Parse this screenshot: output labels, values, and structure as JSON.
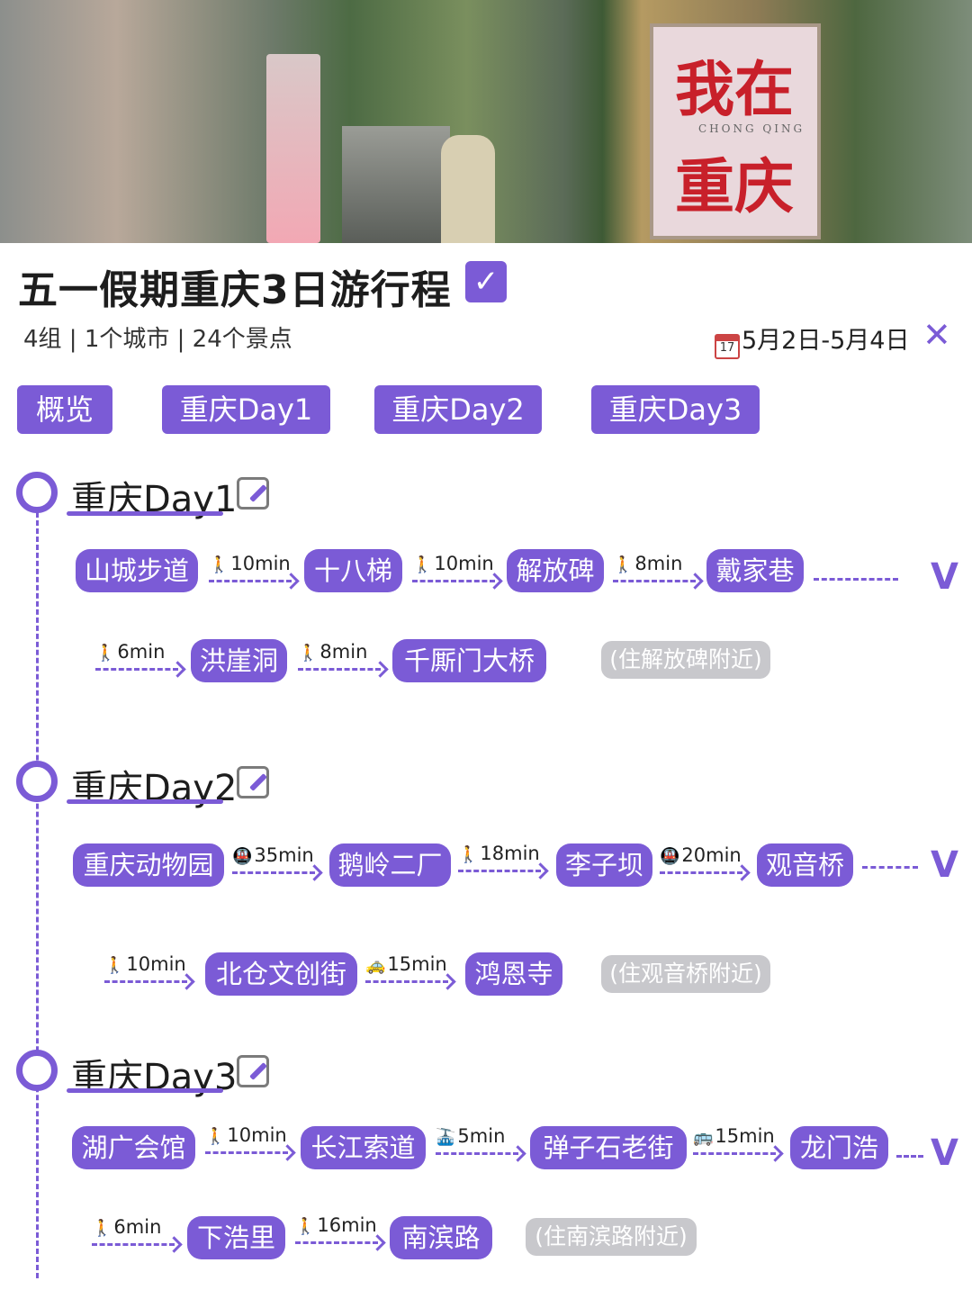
{
  "header": {
    "billboard_line1": "我在",
    "billboard_sub": "CHONG QING",
    "billboard_line2": "重庆"
  },
  "title": "五一假期重庆3日游行程",
  "meta": "4组 | 1个城市 | 24个景点",
  "date_icon_text": "17",
  "date_range": "5月2日-5月4日",
  "close_glyph": "✕",
  "check_glyph": "✓",
  "tabs": [
    "概览",
    "重庆Day1",
    "重庆Day2",
    "重庆Day3"
  ],
  "days": [
    {
      "title": "重庆Day1",
      "spots": [
        "山城步道",
        "十八梯",
        "解放碑",
        "戴家巷",
        "洪崖洞",
        "千厮门大桥"
      ],
      "legs": [
        {
          "mode": "walk",
          "time": "10min"
        },
        {
          "mode": "walk",
          "time": "10min"
        },
        {
          "mode": "walk",
          "time": "8min"
        },
        {
          "mode": "walk",
          "time": "6min"
        },
        {
          "mode": "walk",
          "time": "8min"
        }
      ],
      "stay": "(住解放碑附近)"
    },
    {
      "title": "重庆Day2",
      "spots": [
        "重庆动物园",
        "鹅岭二厂",
        "李子坝",
        "观音桥",
        "北仓文创街",
        "鸿恩寺"
      ],
      "legs": [
        {
          "mode": "metro",
          "time": "35min"
        },
        {
          "mode": "walk",
          "time": "18min"
        },
        {
          "mode": "metro",
          "time": "20min"
        },
        {
          "mode": "walk",
          "time": "10min"
        },
        {
          "mode": "taxi",
          "time": "15min"
        }
      ],
      "stay": "(住观音桥附近)"
    },
    {
      "title": "重庆Day3",
      "spots": [
        "湖广会馆",
        "长江索道",
        "弹子石老街",
        "龙门浩",
        "下浩里",
        "南滨路"
      ],
      "legs": [
        {
          "mode": "walk",
          "time": "10min"
        },
        {
          "mode": "cable",
          "time": "5min"
        },
        {
          "mode": "bus",
          "time": "15min"
        },
        {
          "mode": "walk",
          "time": "6min"
        },
        {
          "mode": "walk",
          "time": "16min"
        }
      ],
      "stay": "(住南滨路附近)"
    }
  ],
  "wrap_marker": "V",
  "icons": {
    "walk": "walking-person-icon",
    "metro": "metro-icon",
    "taxi": "taxi-icon",
    "cable": "cable-car-icon",
    "bus": "bus-icon"
  },
  "colors": {
    "accent": "#7b5bd6",
    "stay_badge": "#c8c8cc"
  }
}
